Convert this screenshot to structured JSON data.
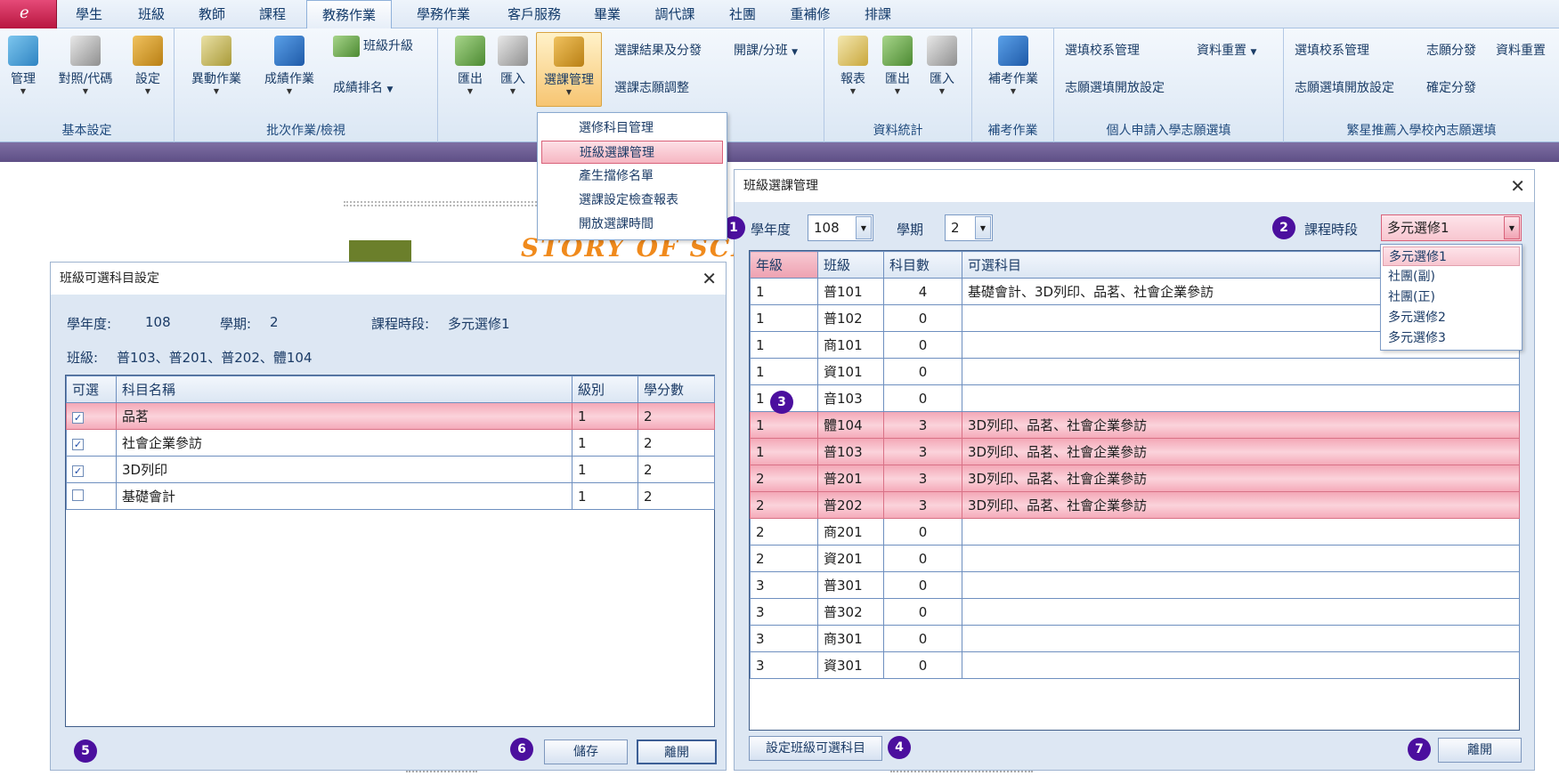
{
  "menu": {
    "tabs": [
      "學生",
      "班級",
      "教師",
      "課程",
      "教務作業",
      "學務作業",
      "客戶服務",
      "畢業",
      "調代課",
      "社團",
      "重補修",
      "排課"
    ],
    "active_tab": "教務作業"
  },
  "ribbon": {
    "group_basic": {
      "label": "基本設定",
      "buttons": [
        "管理",
        "對照/代碼",
        "設定"
      ]
    },
    "group_batch": {
      "label": "批次作業/檢視",
      "buttons": [
        "異動作業",
        "成績作業"
      ],
      "small": [
        "班級升級",
        "成績排名"
      ]
    },
    "group_course": {
      "buttons": [
        "匯出",
        "匯入",
        "選課管理"
      ],
      "small": [
        "選課結果及分發",
        "選課志願調整",
        "開課/分班"
      ]
    },
    "group_stats": {
      "label": "資料統計",
      "buttons": [
        "報表",
        "匯出",
        "匯入"
      ]
    },
    "group_makeup": {
      "label": "補考作業",
      "buttons": [
        "補考作業"
      ]
    },
    "group_personal": {
      "label": "個人申請入學志願選填",
      "small": [
        "選填校系管理",
        "資料重置",
        "志願選填開放設定"
      ]
    },
    "group_star": {
      "label": "繁星推薦入學校內志願選填",
      "small": [
        "選填校系管理",
        "志願分發",
        "資料重置",
        "志願選填開放設定",
        "確定分發"
      ]
    }
  },
  "course_menu": {
    "items": [
      "選修科目管理",
      "班級選課管理",
      "產生擋修名單",
      "選課設定檢查報表",
      "開放選課時間"
    ],
    "selected": "班級選課管理"
  },
  "background": {
    "story_text": "STORY OF SCHO"
  },
  "class_subject_window": {
    "title": "班級可選科目設定",
    "year_label": "學年度:",
    "year_value": "108",
    "sem_label": "學期:",
    "sem_value": "2",
    "period_label": "課程時段:",
    "period_value": "多元選修1",
    "class_label": "班級:",
    "class_value": "普103、普201、普202、體104",
    "columns": [
      "可選",
      "科目名稱",
      "級別",
      "學分數"
    ],
    "rows": [
      {
        "checked": true,
        "name": "品茗",
        "level": "1",
        "credit": "2",
        "highlight": true
      },
      {
        "checked": true,
        "name": "社會企業參訪",
        "level": "1",
        "credit": "2",
        "highlight": false
      },
      {
        "checked": true,
        "name": "3D列印",
        "level": "1",
        "credit": "2",
        "highlight": false
      },
      {
        "checked": false,
        "name": "基礎會計",
        "level": "1",
        "credit": "2",
        "highlight": false
      }
    ],
    "save_label": "儲存",
    "close_label": "離開",
    "badges": [
      "5",
      "6"
    ]
  },
  "class_course_window": {
    "title": "班級選課管理",
    "year_label": "學年度",
    "year_value": "108",
    "sem_label": "學期",
    "sem_value": "2",
    "period_label": "課程時段",
    "period_value": "多元選修1",
    "period_options": [
      "多元選修1",
      "社團(副)",
      "社團(正)",
      "多元選修2",
      "多元選修3"
    ],
    "columns": [
      "年級",
      "班級",
      "科目數",
      "可選科目"
    ],
    "rows": [
      {
        "grade": "1",
        "class": "普101",
        "count": "4",
        "subjects": "基礎會計、3D列印、品茗、社會企業參訪",
        "highlight": false
      },
      {
        "grade": "1",
        "class": "普102",
        "count": "0",
        "subjects": "",
        "highlight": false
      },
      {
        "grade": "1",
        "class": "商101",
        "count": "0",
        "subjects": "",
        "highlight": false
      },
      {
        "grade": "1",
        "class": "資101",
        "count": "0",
        "subjects": "",
        "highlight": false
      },
      {
        "grade": "1",
        "class": "音103",
        "count": "0",
        "subjects": "",
        "highlight": false
      },
      {
        "grade": "1",
        "class": "體104",
        "count": "3",
        "subjects": "3D列印、品茗、社會企業參訪",
        "highlight": true
      },
      {
        "grade": "1",
        "class": "普103",
        "count": "3",
        "subjects": "3D列印、品茗、社會企業參訪",
        "highlight": true
      },
      {
        "grade": "2",
        "class": "普201",
        "count": "3",
        "subjects": "3D列印、品茗、社會企業參訪",
        "highlight": true
      },
      {
        "grade": "2",
        "class": "普202",
        "count": "3",
        "subjects": "3D列印、品茗、社會企業參訪",
        "highlight": true
      },
      {
        "grade": "2",
        "class": "商201",
        "count": "0",
        "subjects": "",
        "highlight": false
      },
      {
        "grade": "2",
        "class": "資201",
        "count": "0",
        "subjects": "",
        "highlight": false
      },
      {
        "grade": "3",
        "class": "普301",
        "count": "0",
        "subjects": "",
        "highlight": false
      },
      {
        "grade": "3",
        "class": "普302",
        "count": "0",
        "subjects": "",
        "highlight": false
      },
      {
        "grade": "3",
        "class": "商301",
        "count": "0",
        "subjects": "",
        "highlight": false
      },
      {
        "grade": "3",
        "class": "資301",
        "count": "0",
        "subjects": "",
        "highlight": false
      }
    ],
    "set_subjects_label": "設定班級可選科目",
    "close_label": "離開",
    "badges": [
      "1",
      "2",
      "3",
      "4",
      "7"
    ]
  },
  "colors": {
    "badge": "#4b0f9e",
    "highlight": "#f4a9b8",
    "menubar": "#dfe9f5"
  }
}
